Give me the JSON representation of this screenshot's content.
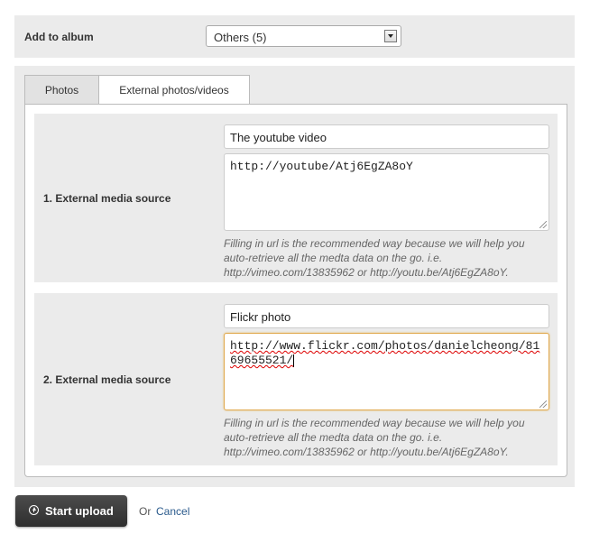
{
  "album": {
    "label": "Add to album",
    "selected": "Others (5)"
  },
  "tabs": [
    {
      "label": "Photos",
      "active": false
    },
    {
      "label": "External photos/videos",
      "active": true
    }
  ],
  "sources": [
    {
      "label": "1. External media source",
      "title_value": "The youtube video",
      "url_value": "http://youtube/Atj6EgZA8oY",
      "hint": "Filling in url is the recommended way because we will help you auto-retrieve all the medta data on the go. i.e. http://vimeo.com/13835962 or http://youtu.be/Atj6EgZA8oY."
    },
    {
      "label": "2. External media source",
      "title_value": "Flickr photo",
      "url_value": "http://www.flickr.com/photos/danielcheong/8169655521/",
      "hint": "Filling in url is the recommended way because we will help you auto-retrieve all the medta data on the go. i.e. http://vimeo.com/13835962 or http://youtu.be/Atj6EgZA8oY."
    }
  ],
  "actions": {
    "upload_label": "Start upload",
    "or_text": "Or",
    "cancel_label": "Cancel"
  },
  "colors": {
    "panel_bg": "#ebebeb",
    "focus_border": "#e0a84e",
    "link": "#2a5a8c",
    "button_bg": "#3a3a3a"
  }
}
